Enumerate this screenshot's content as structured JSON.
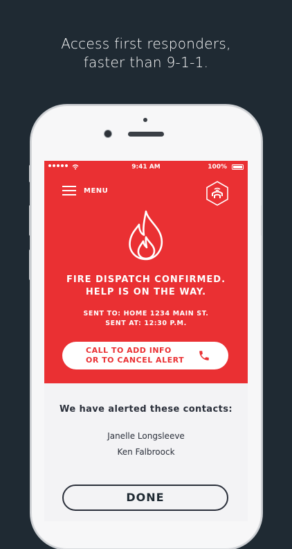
{
  "headline": {
    "line1": "Access first responders,",
    "line2": "faster than 9-1-1."
  },
  "status_bar": {
    "time": "9:41 AM",
    "battery": "100%"
  },
  "header": {
    "menu_label": "MENU"
  },
  "alert": {
    "title_line1": "FIRE DISPATCH CONFIRMED.",
    "title_line2": "HELP IS ON THE WAY.",
    "sent_to": "SENT TO: HOME 1234 MAIN ST.",
    "sent_at": "SENT AT: 12:30 P.M."
  },
  "call_button": {
    "line1": "CALL TO ADD INFO",
    "line2": "OR TO CANCEL ALERT"
  },
  "contacts": {
    "title": "We have alerted these contacts:",
    "items": [
      "Janelle Longsleeve",
      "Ken Falbroock"
    ]
  },
  "done_label": "DONE",
  "colors": {
    "background": "#1f2a33",
    "accent_red": "#ea3033",
    "text_dark": "#2a2f3a"
  },
  "icons": [
    "signal-icon",
    "wifi-icon",
    "battery-icon",
    "hamburger-menu-icon",
    "app-logo-icon",
    "flame-icon",
    "phone-icon"
  ]
}
